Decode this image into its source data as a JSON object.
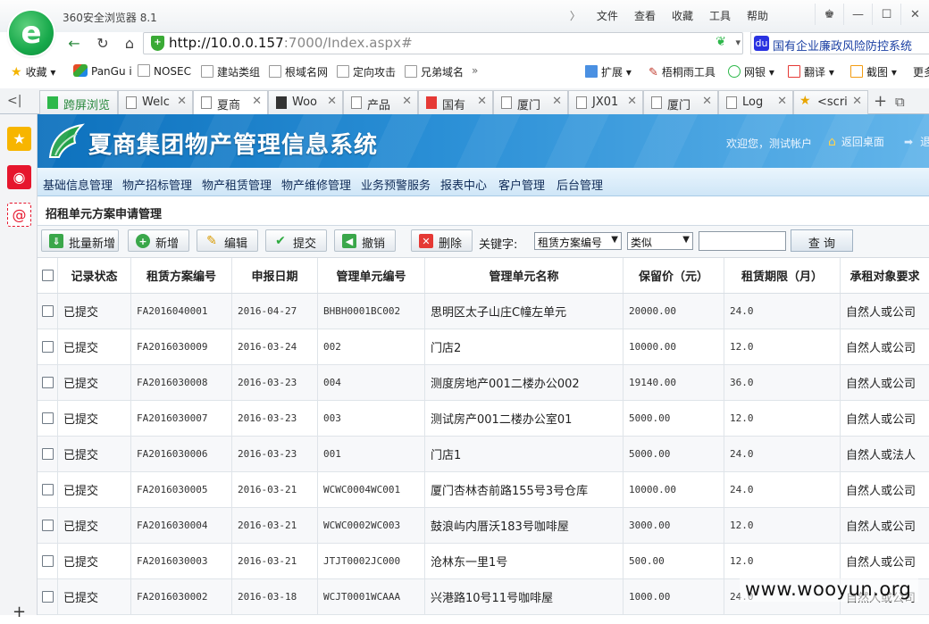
{
  "browser": {
    "title": "360安全浏览器 8.1",
    "menu": [
      "文件",
      "查看",
      "收藏",
      "工具",
      "帮助"
    ],
    "url_host": "http://10.0.0.157",
    "url_rest": ":7000/Index.aspx#",
    "search_text": "国有企业廉政风险防控系统",
    "bookmarks": [
      "收藏",
      "PanGu i",
      "NOSEC",
      "建站类组",
      "根域名网",
      "定向攻击",
      "兄弟域名",
      "扩展",
      "梧桐雨工具",
      "网银",
      "翻译",
      "截图",
      "更多"
    ],
    "tabs": [
      "跨屏浏览",
      "Welc",
      "夏商",
      "Woo",
      "产品",
      "国有",
      "厦门",
      "JX01",
      "厦门",
      "Log",
      "<scri"
    ]
  },
  "app": {
    "title": "夏商集团物产管理信息系统",
    "welcome": "欢迎您，测试帐户",
    "home_link": "返回桌面",
    "logout_link": "退",
    "menu": [
      "基础信息管理",
      "物产招标管理",
      "物产租赁管理",
      "物产维修管理",
      "业务预警服务",
      "报表中心",
      "客户管理",
      "后台管理"
    ],
    "page_title": "招租单元方案申请管理",
    "toolbar": {
      "batch_add": "批量新增",
      "add": "新增",
      "edit": "编辑",
      "submit": "提交",
      "revoke": "撤销",
      "delete": "删除",
      "keyword_label": "关键字:",
      "field_select": "租赁方案编号",
      "match_select": "类似",
      "query": "查 询"
    },
    "table": {
      "headers": [
        "记录状态",
        "租赁方案编号",
        "申报日期",
        "管理单元编号",
        "管理单元名称",
        "保留价（元）",
        "租赁期限（月）",
        "承租对象要求"
      ],
      "rows": [
        [
          "已提交",
          "FA2016040001",
          "2016-04-27",
          "BHBH0001BC002",
          "思明区太子山庄C幢左单元",
          "20000.00",
          "24.0",
          "自然人或公司"
        ],
        [
          "已提交",
          "FA2016030009",
          "2016-03-24",
          "002",
          "门店2",
          "10000.00",
          "12.0",
          "自然人或公司"
        ],
        [
          "已提交",
          "FA2016030008",
          "2016-03-23",
          "004",
          "测度房地产001二楼办公002",
          "19140.00",
          "36.0",
          "自然人或公司"
        ],
        [
          "已提交",
          "FA2016030007",
          "2016-03-23",
          "003",
          "测试房产001二楼办公室01",
          "5000.00",
          "12.0",
          "自然人或公司"
        ],
        [
          "已提交",
          "FA2016030006",
          "2016-03-23",
          "001",
          "门店1",
          "5000.00",
          "24.0",
          "自然人或法人"
        ],
        [
          "已提交",
          "FA2016030005",
          "2016-03-21",
          "WCWC0004WC001",
          "厦门杏林杏前路155号3号仓库",
          "10000.00",
          "24.0",
          "自然人或公司"
        ],
        [
          "已提交",
          "FA2016030004",
          "2016-03-21",
          "WCWC0002WC003",
          "鼓浪屿内厝沃183号咖啡屋",
          "3000.00",
          "12.0",
          "自然人或公司"
        ],
        [
          "已提交",
          "FA2016030003",
          "2016-03-21",
          "JTJT0002JC000",
          "沧林东一里1号",
          "500.00",
          "12.0",
          "自然人或公司"
        ],
        [
          "已提交",
          "FA2016030002",
          "2016-03-18",
          "WCJT0001WCAAA",
          "兴港路10号11号咖啡屋",
          "1000.00",
          "24.0",
          "自然人或公司"
        ]
      ]
    }
  },
  "watermark": "www.wooyun.org"
}
